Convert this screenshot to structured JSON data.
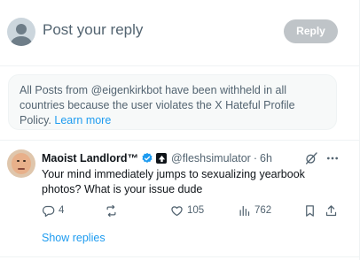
{
  "composer": {
    "placeholder": "Post your reply",
    "reply_label": "Reply"
  },
  "notice": {
    "text": "All Posts from @eigenkirkbot have been withheld in all countries because the user violates the X Hateful Profile Policy.",
    "link": "Learn more"
  },
  "tweet": {
    "author_name": "Maoist Landlord™",
    "handle": "@fleshsimulator",
    "separator": "·",
    "time": "6h",
    "text": "Your mind immediately jumps to sexualizing yearbook photos? What is your issue dude",
    "replies": "4",
    "likes": "105",
    "views": "762"
  },
  "show_replies": "Show replies",
  "colors": {
    "accent": "#1d9bf0",
    "secondary_text": "#536471",
    "reply_button_disabled": "#bfc4c8"
  }
}
